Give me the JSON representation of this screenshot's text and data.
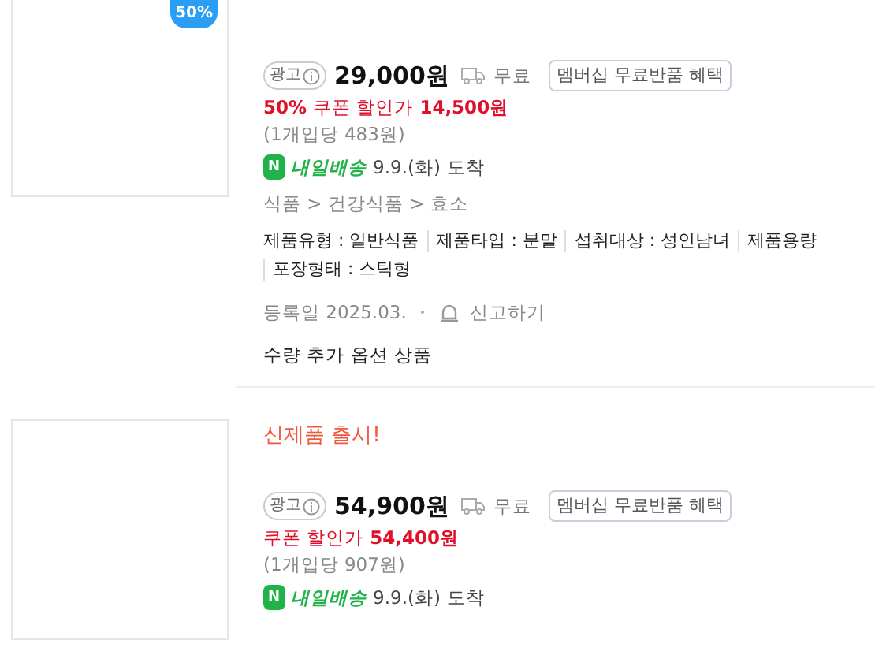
{
  "products": [
    {
      "badge": "50%",
      "ad_label": "광고",
      "price": "29,000원",
      "shipping": "무료",
      "benefit": "멤버십 무료반품 혜택",
      "discount_rate": "50%",
      "coupon_label": "쿠폰 할인가",
      "coupon_price": "14,500원",
      "unit_price": "(1개입당 483원)",
      "delivery_badge": "N",
      "delivery_brand": "내일배송",
      "delivery_date": "9.9.(화)",
      "delivery_suffix": "도착",
      "category": "식품 > 건강식품 > 효소",
      "attributes": [
        "제품유형 : 일반식품",
        "제품타입 : 분말",
        "섭취대상 : 성인남녀",
        "제품용량",
        "포장형태 : 스틱형"
      ],
      "registered": "등록일 2025.03.",
      "report": "신고하기",
      "option_note": "수량 추가 옵션 상품"
    },
    {
      "headline": "신제품 출시!",
      "ad_label": "광고",
      "price": "54,900원",
      "shipping": "무료",
      "benefit": "멤버십 무료반품 혜택",
      "coupon_label": "쿠폰 할인가",
      "coupon_price": "54,400원",
      "unit_price": "(1개입당 907원)",
      "delivery_badge": "N",
      "delivery_brand": "내일배송",
      "delivery_date": "9.9.(화)",
      "delivery_suffix": "도착"
    }
  ]
}
